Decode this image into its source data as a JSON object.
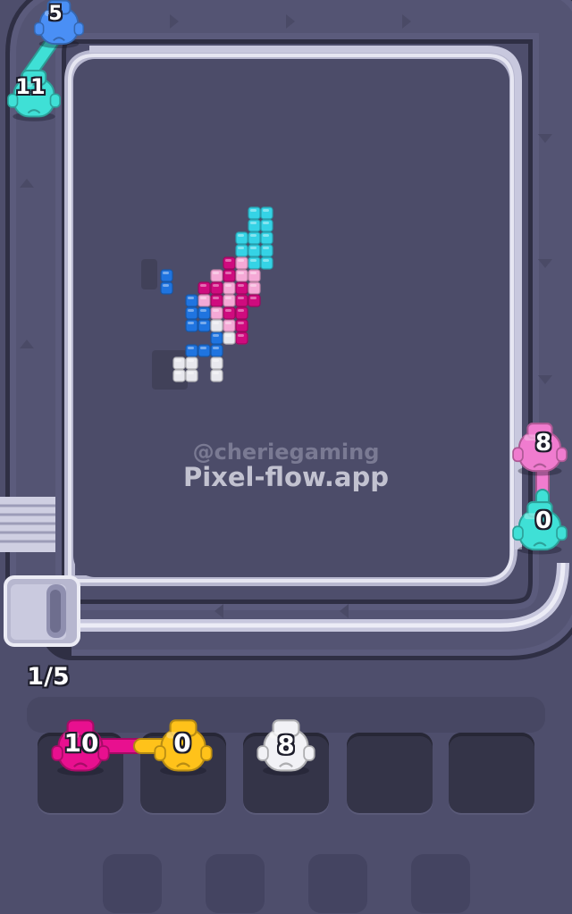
{
  "watermark": {
    "handle": "@cheriegaming",
    "site": "Pixel-flow.app"
  },
  "progress": {
    "label": "1/5",
    "current": 1,
    "total": 5
  },
  "conveyor_shooters": [
    {
      "color": "#4a8ff5",
      "color_name": "blue",
      "count": "5"
    },
    {
      "color": "#3fe0d6",
      "color_name": "cyan",
      "count": "11"
    },
    {
      "color": "#f07ccf",
      "color_name": "pink",
      "count": "8"
    },
    {
      "color": "#3fe0d6",
      "color_name": "cyan",
      "count": "0"
    }
  ],
  "queue": [
    {
      "color": "#e8108f",
      "color_name": "magenta",
      "count": "10",
      "linked": true
    },
    {
      "color": "#ffc21a",
      "color_name": "yellow",
      "count": "0",
      "linked": true
    },
    {
      "color": "#f2f2f6",
      "color_name": "white",
      "count": "8",
      "linked": false
    }
  ],
  "queue_slots": {
    "filled": 3,
    "total": 5
  },
  "locked_slots": 4,
  "pixel_art_colors": {
    "cyan": "#35d3e6",
    "pink": "#f5a9d6",
    "magenta": "#cf0b7e",
    "blue": "#1f74e0",
    "white": "#e8e8ee"
  },
  "icons": {
    "shooter": "pig-shooter-icon",
    "feeder": "conveyor-feeder-icon",
    "arrow": "conveyor-arrow-icon"
  }
}
